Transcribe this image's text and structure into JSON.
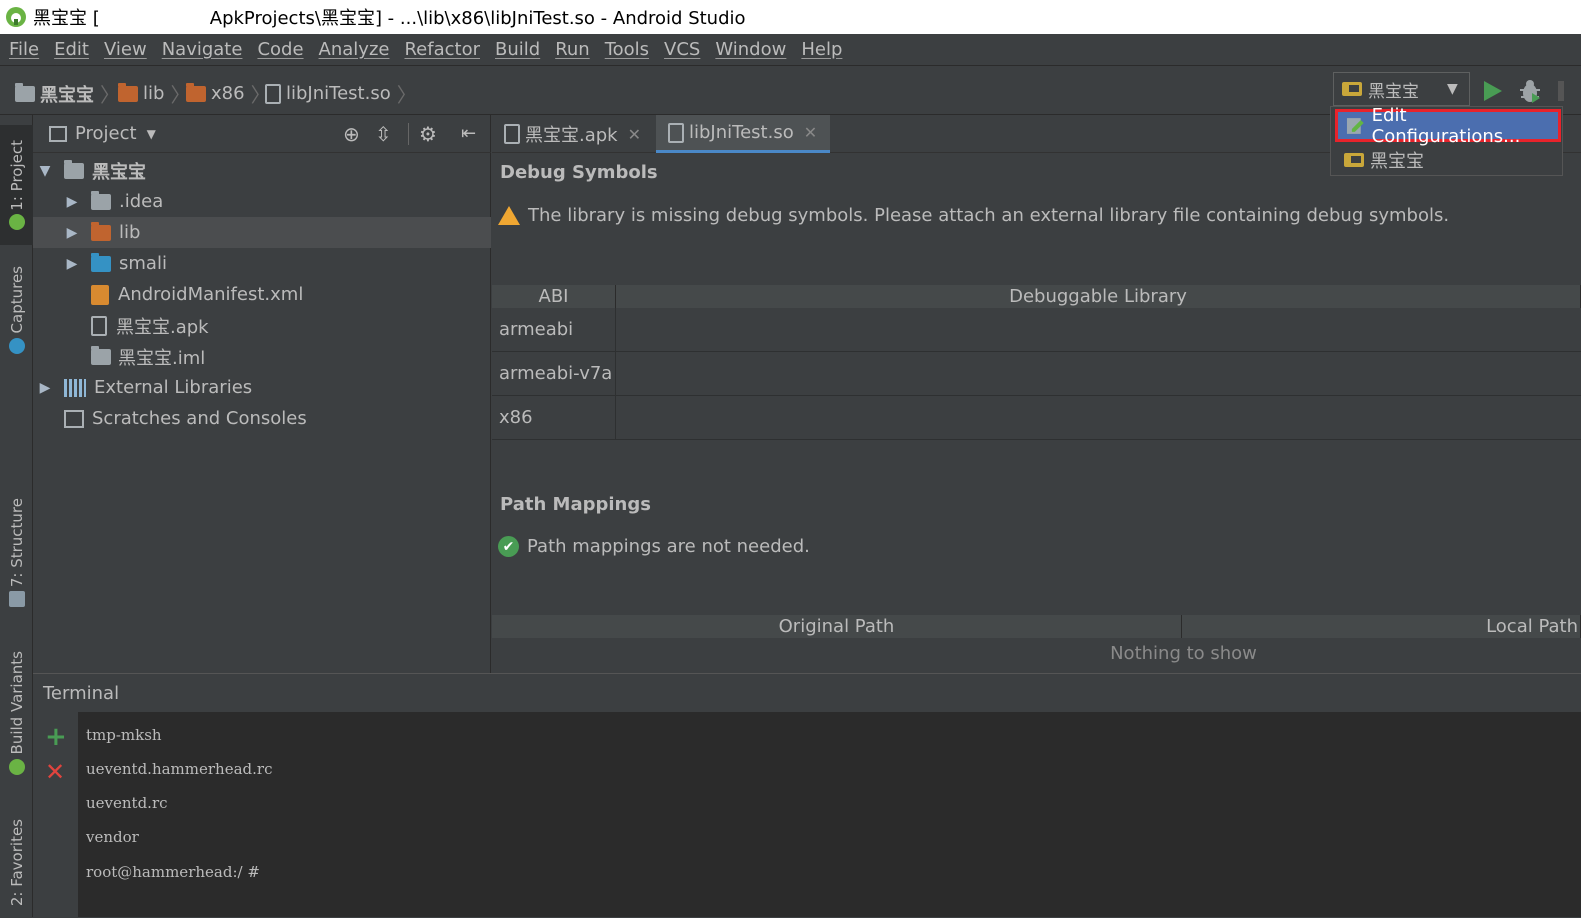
{
  "window": {
    "title_left": "黑宝宝 [",
    "title_right": "ApkProjects\\黑宝宝] - ...\\lib\\x86\\libJniTest.so - Android Studio"
  },
  "menu": [
    "File",
    "Edit",
    "View",
    "Navigate",
    "Code",
    "Analyze",
    "Refactor",
    "Build",
    "Run",
    "Tools",
    "VCS",
    "Window",
    "Help"
  ],
  "breadcrumb": [
    "黑宝宝",
    "lib",
    "x86",
    "libJniTest.so"
  ],
  "run_config": {
    "selected": "黑宝宝",
    "options": [
      "Edit Configurations...",
      "黑宝宝"
    ]
  },
  "left_tool_tabs": [
    "1: Project",
    "Captures",
    "7: Structure",
    "Build Variants",
    "2: Favorites"
  ],
  "project_panel": {
    "title": "Project",
    "tree": [
      {
        "label": "黑宝宝",
        "expanded": true
      },
      {
        "label": ".idea"
      },
      {
        "label": "lib",
        "selected": true
      },
      {
        "label": "smali"
      },
      {
        "label": "AndroidManifest.xml"
      },
      {
        "label": "黑宝宝.apk"
      },
      {
        "label": "黑宝宝.iml"
      },
      {
        "label": "External Libraries"
      },
      {
        "label": "Scratches and Consoles"
      }
    ]
  },
  "editor": {
    "tabs": [
      {
        "label": "黑宝宝.apk"
      },
      {
        "label": "libJniTest.so",
        "active": true
      }
    ],
    "debug_symbols": {
      "heading": "Debug Symbols",
      "warning": "The library is missing debug symbols. Please attach an external library file containing debug symbols.",
      "columns": [
        "ABI",
        "Debuggable Library"
      ],
      "rows": [
        "armeabi",
        "armeabi-v7a",
        "x86"
      ]
    },
    "path_mappings": {
      "heading": "Path Mappings",
      "message": "Path mappings are not needed.",
      "columns": [
        "Original Path",
        "Local Path"
      ],
      "empty": "Nothing to show"
    }
  },
  "terminal": {
    "title": "Terminal",
    "lines": [
      "tmp-mksh",
      "ueventd.hammerhead.rc",
      "ueventd.rc",
      "vendor",
      "root@hammerhead:/ #"
    ]
  },
  "colors": {
    "accent": "#4b6eaf",
    "run_green": "#499c54",
    "highlight_red": "#e8232b"
  }
}
